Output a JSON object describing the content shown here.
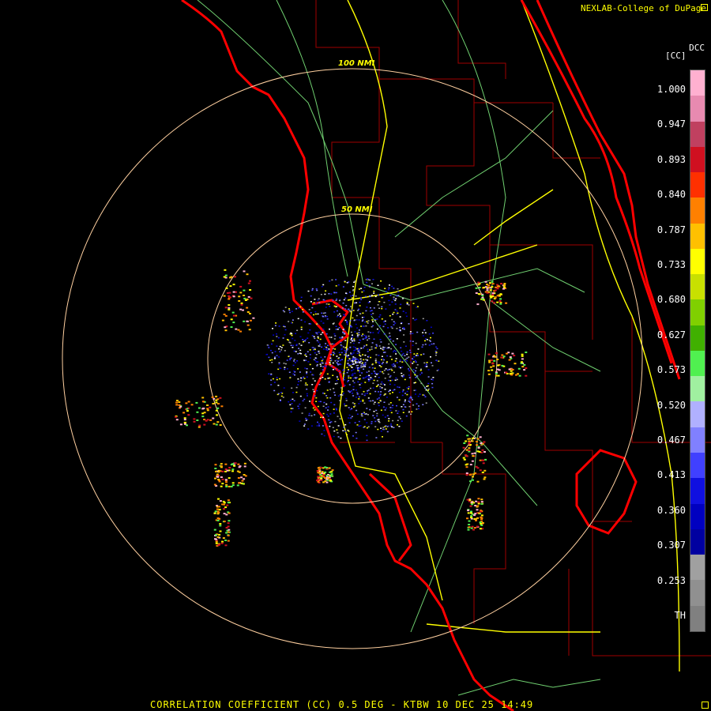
{
  "header": {
    "credit": "NEXLAB-College of DuPage",
    "product_code": "DCC"
  },
  "colorbar": {
    "unit": "[CC]",
    "ticks": [
      "1.000",
      "0.947",
      "0.893",
      "0.840",
      "0.787",
      "0.733",
      "0.680",
      "0.627",
      "0.573",
      "0.520",
      "0.467",
      "0.413",
      "0.360",
      "0.307",
      "0.253",
      "TH"
    ],
    "colors": [
      "#ffb0d0",
      "#e88ab0",
      "#c04060",
      "#d01020",
      "#ff3000",
      "#ff8000",
      "#ffc000",
      "#ffff00",
      "#c8e000",
      "#80d000",
      "#40b000",
      "#50f050",
      "#a0f0a0",
      "#b0b0ff",
      "#8080ff",
      "#4040ff",
      "#1010e0",
      "#0000c0",
      "#0000a0",
      "#a0a0a0",
      "#909090",
      "#808080"
    ]
  },
  "map": {
    "range_rings": [
      {
        "label": "50 NMI"
      },
      {
        "label": "100 NMI"
      }
    ],
    "colors": {
      "coast": "#ff0000",
      "county": "#a00000",
      "highway": "#ffff00",
      "road": "#80e080",
      "ring": "#ffd0a0"
    }
  },
  "footer": {
    "caption": "CORRELATION COEFFICIENT (CC) 0.5 DEG - KTBW 10 DEC 25 14:49"
  }
}
